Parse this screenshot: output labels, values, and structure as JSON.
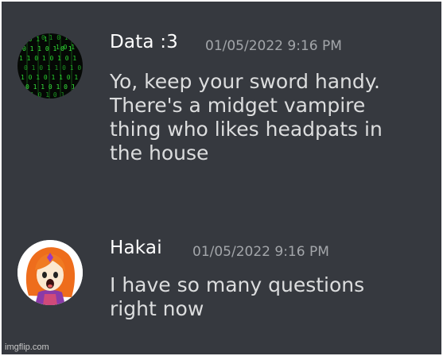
{
  "messages": [
    {
      "username": "Data :3",
      "timestamp": "01/05/2022 9:16 PM",
      "avatar": "matrix-code-avatar",
      "lines": [
        "Yo, keep your sword handy.",
        "There's a midget vampire",
        "thing who likes headpats in",
        "the house"
      ]
    },
    {
      "username": "Hakai",
      "timestamp": "01/05/2022 9:16 PM",
      "avatar": "anime-character-avatar",
      "lines": [
        "I have so many questions",
        "right now"
      ]
    }
  ],
  "watermark": "imgflip.com",
  "colors": {
    "background": "#36393f",
    "username": "#ffffff",
    "timestamp": "#a3a6aa",
    "message_text": "#dcddde"
  }
}
